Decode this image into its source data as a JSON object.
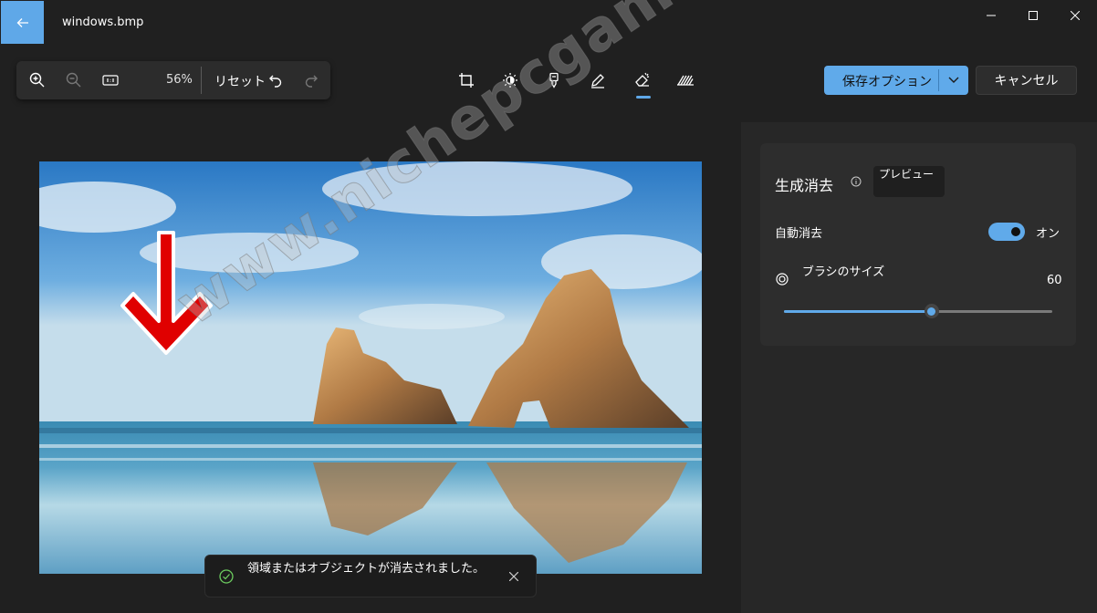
{
  "window": {
    "title": "windows.bmp"
  },
  "zoom_bar": {
    "zoom": "56%",
    "reset_label": "リセット"
  },
  "tools": [
    "crop-icon",
    "brightness-icon",
    "retouch-icon",
    "markup-icon",
    "erase-icon",
    "background-icon"
  ],
  "actions": {
    "save_label": "保存オプション",
    "cancel_label": "キャンセル"
  },
  "panel": {
    "title": "生成消去",
    "badge": "プレビュー",
    "auto_erase_label": "自動消去",
    "auto_erase_state": "オン",
    "auto_erase_on": true,
    "brush_label": "ブラシのサイズ",
    "brush_value": "60",
    "brush_fraction": 0.55
  },
  "toast": {
    "message": "領域またはオブジェクトが消去されました。"
  },
  "watermark": {
    "text": "www.nichepcgamer.com"
  },
  "colors": {
    "accent": "#60aaea",
    "background": "#202020",
    "panel": "#2d2d2d",
    "arrow": "#e00000"
  }
}
